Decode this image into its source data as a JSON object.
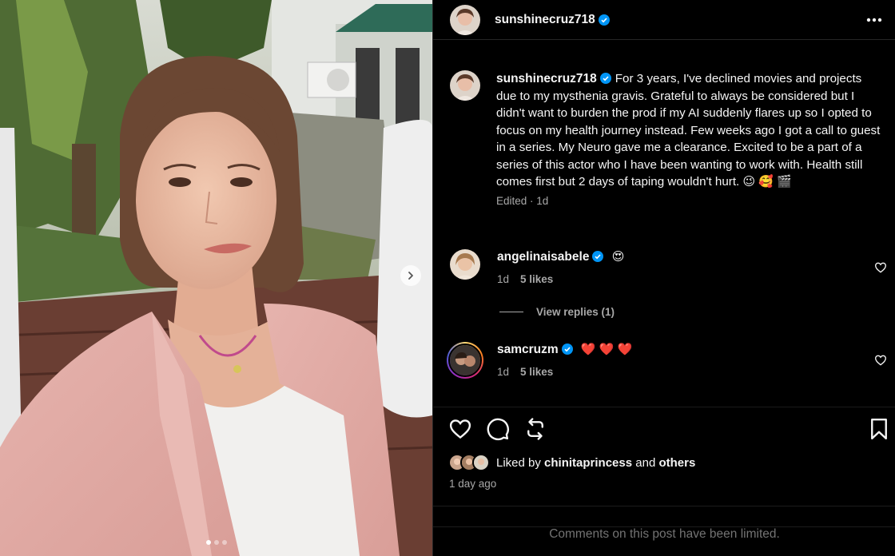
{
  "post": {
    "author": "sunshinecruz718",
    "more_icon": "more-horizontal-icon",
    "caption": "For 3 years, I've declined movies and projects due to my mysthenia gravis. Grateful to always be considered but I didn't want to burden the prod if my AI suddenly flares up so I opted to focus on my health journey instead. Few weeks ago I got a call to guest in a series. My Neuro gave me a clearance. Excited to be a part of a series of this actor who I have been wanting to work with. Health still comes first but 2 days of taping wouldn't hurt.",
    "caption_emojis": "😉 🥰 🎬",
    "edited": "Edited",
    "edited_age": "1d",
    "carousel": {
      "slides": 3,
      "active_index": 0
    }
  },
  "comments": [
    {
      "user": "angelinaisabele",
      "text": "😍",
      "age": "1d",
      "likes": "5 likes"
    },
    {
      "user": "samcruzm",
      "text": "❤️ ❤️ ❤️",
      "age": "1d",
      "likes": "5 likes"
    }
  ],
  "view_replies": "View replies (1)",
  "liked_by": {
    "prefix": "Liked by",
    "user": "chinitaprincess",
    "and": "and",
    "others": "others"
  },
  "timestamp": "1 day ago",
  "comments_limited": "Comments on this post have been limited.",
  "colors": {
    "background": "#000000",
    "verified": "#0095f6",
    "secondary_text": "#a8a8a8",
    "heart": "#ff3040"
  }
}
